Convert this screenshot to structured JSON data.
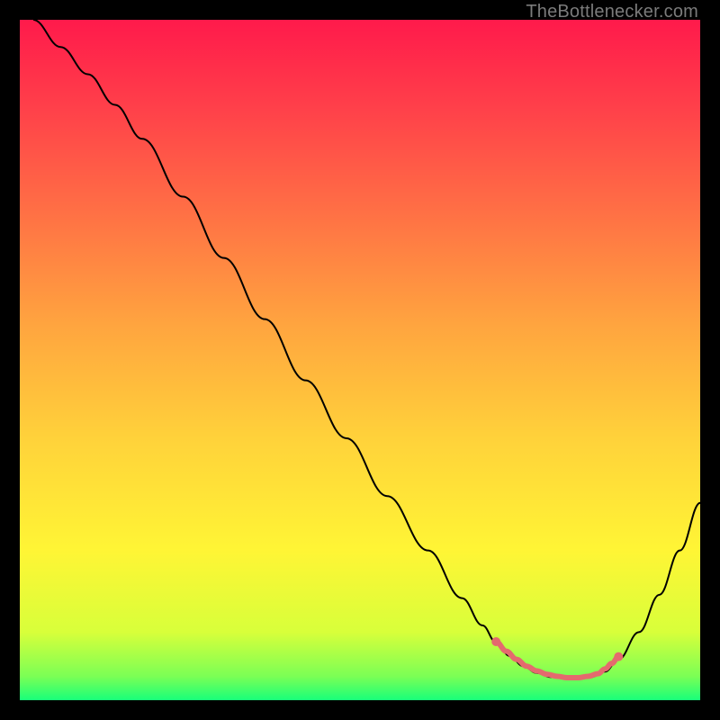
{
  "watermark": "TheBottlenecker.com",
  "chart_data": {
    "type": "line",
    "title": "",
    "xlabel": "",
    "ylabel": "",
    "xlim": [
      0,
      100
    ],
    "ylim": [
      0,
      100
    ],
    "grid": false,
    "gradient_stops": [
      {
        "offset": 0.0,
        "color": "#ff1a4b"
      },
      {
        "offset": 0.12,
        "color": "#ff3d4a"
      },
      {
        "offset": 0.28,
        "color": "#ff6f45"
      },
      {
        "offset": 0.45,
        "color": "#ffa53f"
      },
      {
        "offset": 0.62,
        "color": "#ffd33a"
      },
      {
        "offset": 0.78,
        "color": "#fff535"
      },
      {
        "offset": 0.9,
        "color": "#d8ff3a"
      },
      {
        "offset": 0.965,
        "color": "#7bff55"
      },
      {
        "offset": 1.0,
        "color": "#18ff7a"
      }
    ],
    "series": [
      {
        "name": "bottleneck-curve",
        "stroke": "#000000",
        "x": [
          2,
          6,
          10,
          14,
          18,
          24,
          30,
          36,
          42,
          48,
          54,
          60,
          65,
          68,
          70,
          72,
          74,
          76,
          78,
          80,
          82,
          84,
          86,
          88,
          91,
          94,
          97,
          100
        ],
        "y": [
          100,
          96,
          92,
          87.5,
          82.5,
          74,
          65,
          56,
          47,
          38.5,
          30,
          22,
          15,
          11,
          8.5,
          6.5,
          5,
          4,
          3.4,
          3.2,
          3.2,
          3.4,
          4.2,
          6,
          10,
          15.5,
          22,
          29
        ]
      },
      {
        "name": "optimal-band-highlight",
        "stroke": "#e46a6e",
        "stroke_width": 6,
        "linecap": "round",
        "x": [
          70,
          71.5,
          73,
          74.5,
          76,
          77.5,
          79,
          80.5,
          82,
          83.5,
          85,
          86,
          87,
          88
        ],
        "y": [
          8.6,
          7.2,
          6.0,
          5.0,
          4.3,
          3.8,
          3.5,
          3.3,
          3.3,
          3.5,
          3.9,
          4.6,
          5.4,
          6.4
        ]
      }
    ],
    "annotations": []
  }
}
